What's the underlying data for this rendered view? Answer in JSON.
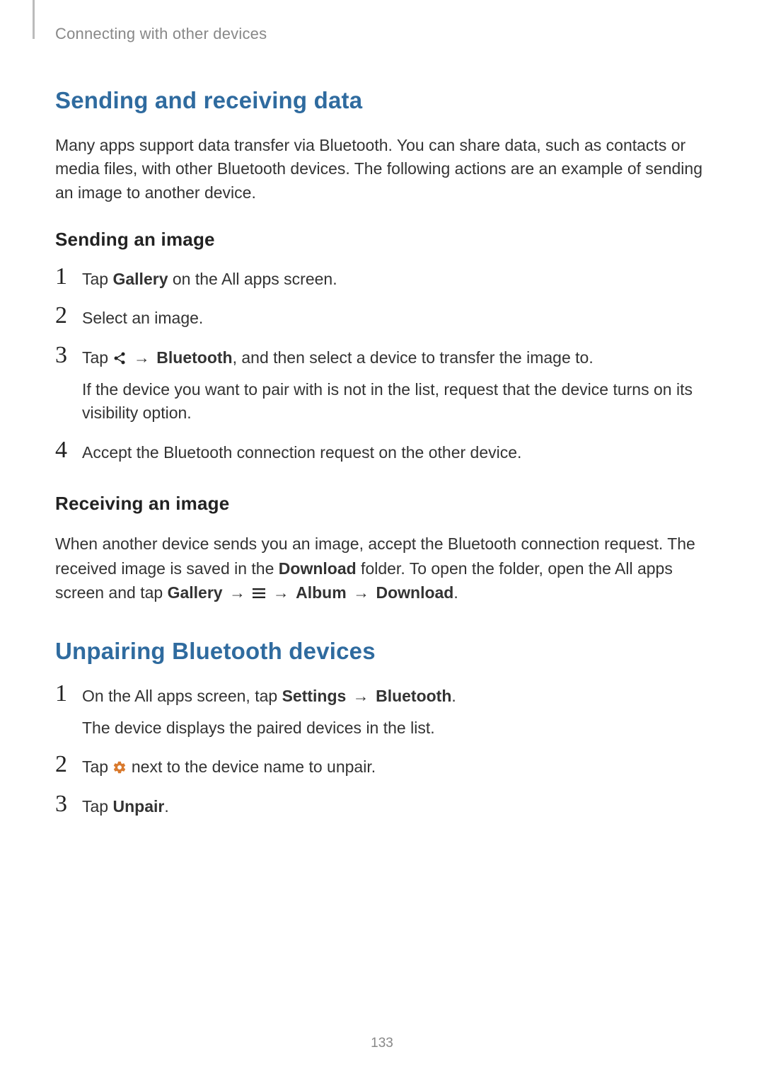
{
  "breadcrumb": "Connecting with other devices",
  "section1": {
    "title": "Sending and receiving data",
    "intro": "Many apps support data transfer via Bluetooth. You can share data, such as contacts or media files, with other Bluetooth devices. The following actions are an example of sending an image to another device.",
    "sending": {
      "heading": "Sending an image",
      "step1_prefix": "Tap ",
      "step1_bold": "Gallery",
      "step1_suffix": " on the All apps screen.",
      "step2": "Select an image.",
      "step3_prefix": "Tap ",
      "step3_arrow": " → ",
      "step3_bold": "Bluetooth",
      "step3_suffix": ", and then select a device to transfer the image to.",
      "step3_sub": "If the device you want to pair with is not in the list, request that the device turns on its visibility option.",
      "step4": "Accept the Bluetooth connection request on the other device."
    },
    "receiving": {
      "heading": "Receiving an image",
      "p_a": "When another device sends you an image, accept the Bluetooth connection request. The received image is saved in the ",
      "p_b_bold": "Download",
      "p_c": " folder. To open the folder, open the All apps screen and tap ",
      "p_d_bold": "Gallery",
      "p_e": " → ",
      "p_f": " → ",
      "p_g_bold": "Album",
      "p_h": " → ",
      "p_i_bold": "Download",
      "p_j": "."
    }
  },
  "section2": {
    "title": "Unpairing Bluetooth devices",
    "step1_prefix": "On the All apps screen, tap ",
    "step1_bold1": "Settings",
    "step1_arrow": " → ",
    "step1_bold2": "Bluetooth",
    "step1_suffix": ".",
    "step1_sub": "The device displays the paired devices in the list.",
    "step2_prefix": "Tap ",
    "step2_suffix": " next to the device name to unpair.",
    "step3_prefix": "Tap ",
    "step3_bold": "Unpair",
    "step3_suffix": "."
  },
  "page_number": "133"
}
